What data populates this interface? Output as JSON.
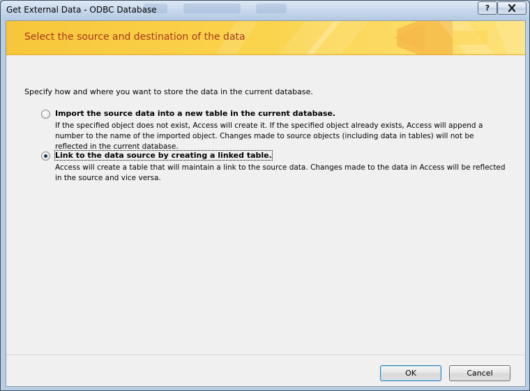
{
  "window": {
    "title": "Get External Data - ODBC Database",
    "help_label": "?"
  },
  "banner": {
    "title": "Select the source and destination of the data"
  },
  "instruction": "Specify how and where you want to store the data in the current database.",
  "options": [
    {
      "label": "Import the source data into a new table in the current database.",
      "description": "If the specified object does not exist, Access will create it. If the specified object already exists, Access will append a number to the name of the imported object. Changes made to source objects (including data in tables) will not be reflected in the current database.",
      "selected": false
    },
    {
      "label": "Link to the data source by creating a linked table.",
      "description": "Access will create a table that will maintain a link to the source data. Changes made to the data in Access will be reflected in the source and vice versa.",
      "selected": true
    }
  ],
  "buttons": {
    "ok": "OK",
    "cancel": "Cancel"
  },
  "colors": {
    "banner": "#fbd44d",
    "banner_title": "#a8391f"
  },
  "icons": {
    "help": "help-icon",
    "close": "close-icon"
  }
}
